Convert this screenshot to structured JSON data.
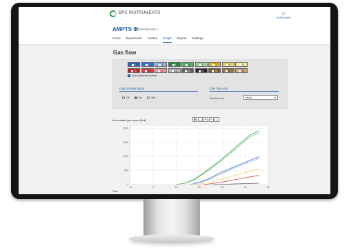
{
  "brand": {
    "name": "BPC INSTRUMENTS"
  },
  "user": {
    "name": "USER NAME"
  },
  "app": {
    "title": "AMPTS III",
    "subtitle": "Show test unit 1"
  },
  "tabs": [
    {
      "label": "Home",
      "active": false
    },
    {
      "label": "Experiment",
      "active": false
    },
    {
      "label": "Control",
      "active": false
    },
    {
      "label": "Graph",
      "active": true
    },
    {
      "label": "Report",
      "active": false
    },
    {
      "label": "Settings",
      "active": false
    }
  ],
  "page_title": "Gas flow",
  "flow_cells": {
    "row1": [
      {
        "label": "1",
        "color": "#2f5fb6"
      },
      {
        "label": "2",
        "color": "#3a6cc6"
      },
      {
        "label": "3",
        "color": "#8eb0e6"
      },
      {
        "label": "4",
        "color": "#1e8a3a"
      },
      {
        "label": "5",
        "color": "#58b068"
      },
      {
        "label": "6",
        "color": "#a6cf9c"
      },
      {
        "label": "7",
        "color": "#e0b020"
      },
      {
        "label": "8",
        "color": "#ecd060"
      },
      {
        "label": "9",
        "color": "#f4e89c"
      }
    ],
    "row2": [
      {
        "label": "10",
        "color": "#c02020"
      },
      {
        "label": "11",
        "color": "#d84040"
      },
      {
        "label": "12",
        "color": "#ee9a9a"
      },
      {
        "label": "13",
        "color": "#b4b4b4"
      },
      {
        "label": "14",
        "color": "#646464"
      },
      {
        "label": "15",
        "color": "#222222"
      },
      {
        "label": "16",
        "color": "#7a5828"
      },
      {
        "label": "17",
        "color": "#9c7844"
      },
      {
        "label": "18",
        "color": "#c6a878"
      }
    ]
  },
  "checkbox_label": "Select/Unselect all lines",
  "normalization": {
    "heading": "Gas normalization",
    "options": [
      {
        "label": "Off",
        "selected": false
      },
      {
        "label": "Dry",
        "selected": true
      },
      {
        "label": "Wet",
        "selected": false
      }
    ]
  },
  "unit": {
    "heading": "Gas flow unit",
    "label": "Gas flow unit",
    "value": "Nml/h"
  },
  "chart_label": "Accumulated gas volume [Nml]",
  "x_axis_label": "Time",
  "toolbar": {
    "icons": [
      "zoom-icon",
      "pan-icon",
      "zoom-in-icon",
      "zoom-out-icon",
      "reset-zoom-icon"
    ]
  },
  "chart_data": {
    "type": "line",
    "title": "",
    "xlabel": "Time",
    "ylabel": "Accumulated gas volume [Nml]",
    "xlim": [
      -10,
      50
    ],
    "ylim": [
      0,
      2100
    ],
    "x_ticks": [
      -10,
      0,
      10,
      20,
      30,
      40,
      50
    ],
    "y_ticks": [
      0,
      500,
      1000,
      1500,
      2000
    ],
    "grid": true,
    "series": [
      {
        "color": "#2ea84d",
        "x": [
          10,
          14,
          18,
          22,
          26,
          30,
          34,
          38,
          42,
          46
        ],
        "y": [
          0,
          60,
          200,
          420,
          660,
          920,
          1200,
          1480,
          1750,
          1910
        ]
      },
      {
        "color": "#72c47a",
        "x": [
          10,
          14,
          18,
          22,
          26,
          30,
          34,
          38,
          42,
          46
        ],
        "y": [
          0,
          50,
          180,
          390,
          620,
          870,
          1140,
          1420,
          1680,
          1840
        ]
      },
      {
        "color": "#3a6cc6",
        "x": [
          16,
          20,
          24,
          28,
          32,
          36,
          40,
          44,
          46
        ],
        "y": [
          0,
          80,
          200,
          380,
          520,
          660,
          790,
          930,
          990
        ]
      },
      {
        "color": "#8eb0e6",
        "x": [
          16,
          20,
          24,
          28,
          32,
          36,
          40,
          44,
          46
        ],
        "y": [
          0,
          60,
          170,
          330,
          470,
          610,
          740,
          870,
          930
        ]
      },
      {
        "color": "#ecd060",
        "x": [
          18,
          22,
          26,
          30,
          34,
          38,
          42,
          46
        ],
        "y": [
          0,
          40,
          110,
          200,
          290,
          380,
          470,
          560
        ]
      },
      {
        "color": "#d84040",
        "x": [
          22,
          26,
          30,
          34,
          38,
          42,
          46
        ],
        "y": [
          0,
          40,
          90,
          150,
          210,
          270,
          330
        ]
      },
      {
        "color": "#646464",
        "x": [
          26,
          30,
          34,
          38,
          42,
          46
        ],
        "y": [
          0,
          10,
          20,
          30,
          40,
          50
        ]
      }
    ]
  }
}
